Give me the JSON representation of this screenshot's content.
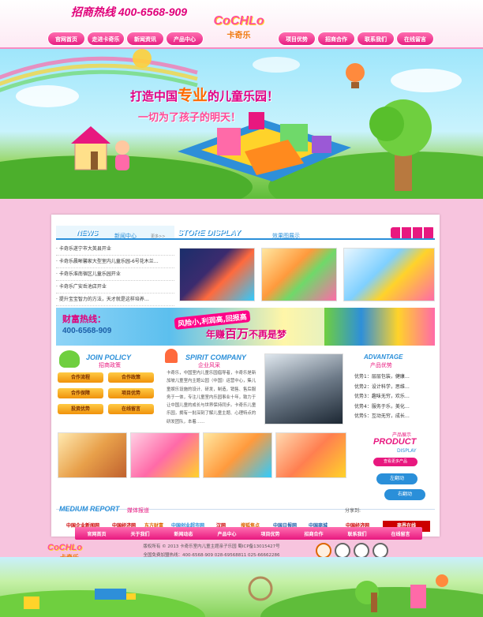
{
  "header": {
    "hotline_label": "招商热线",
    "hotline_number": "400-6568-909",
    "logo_en": "CoCHLo",
    "logo_cn": "卡奇乐"
  },
  "nav_left": [
    "官网首页",
    "走进卡奇乐",
    "新闻资讯",
    "产品中心"
  ],
  "nav_right": [
    "项目优势",
    "招商合作",
    "联系我们",
    "在线留言"
  ],
  "banner": {
    "slogan_a": "打造中国",
    "slogan_b": "专业",
    "slogan_c": "的儿童乐园！",
    "slogan2": "一切为了孩子的明天！",
    "dots": "●○○"
  },
  "news": {
    "title": "NEWS",
    "subtitle": "新闻中心",
    "more": "更多>>",
    "items": [
      "卡奇乐遂宁市大英县开业",
      "卡奇乐晨晰馨家大型室内儿童乐园-6号花木兰…",
      "卡奇乐淮南宿区儿童乐园开业",
      "卡奇乐广安岳池店开业",
      "提升宝宝智力的方法，天才就是这样培养…"
    ]
  },
  "store": {
    "title": "STORE DISPLAY",
    "subtitle": "效果图展示"
  },
  "hotbar": {
    "label": "财富热线：",
    "number": "400-6568-909",
    "tag": "风险小,利润高,回报高",
    "slogan_a": "年赚",
    "slogan_b": "百万",
    "slogan_c": "不再是梦"
  },
  "join": {
    "title": "JOIN POLICY",
    "subtitle": "招商政策",
    "buttons": [
      "合作流程",
      "合作政策",
      "合作保障",
      "项目优势",
      "投资优势",
      "在线留言"
    ]
  },
  "spirit": {
    "title": "SPIRIT COMPANY",
    "subtitle": "企业风采",
    "text": "卡奇乐，中国室内儿童乐园倡导者，卡奇乐是新加坡儿童室内主题公园（中国）运营中心，集儿童娱乐设施的设计、研发，制造，销售、售后服务于一体，专注儿童室内乐园事业十年，致力于让中国儿童的成长与世界保持同步。卡奇乐儿童乐园，拥有一批深刻了解儿童主题、心理特点的研发团队，本着……"
  },
  "advantage": {
    "title": "ADVANTAGE",
    "subtitle": "产品优势",
    "items": [
      "优势1：层层包装，健康…",
      "优势2：设计科学，思维…",
      "优势3：趣味无穷，欢乐…",
      "优势4：服务于乐，美化…",
      "优势5：互动无穷，成长…"
    ]
  },
  "product": {
    "title_cn": "产品展示",
    "title_en1": "PRODUCT",
    "title_en2": "DISPLAY",
    "more": "查看更多产品",
    "left": "左翻动",
    "right": "右翻动"
  },
  "media": {
    "title": "MEDIUM REPORT",
    "subtitle": "媒体报道",
    "share": "分享到:",
    "logos": [
      "中国企业新闻网",
      "中国经济网",
      "东方财富",
      "中国创业超市网",
      "汉网",
      "搜狐焦点",
      "中国日报网",
      "中国商城",
      "中国经济网",
      "商界在线"
    ]
  },
  "footer": {
    "nav": [
      "官网首页",
      "关于我们",
      "新闻动态",
      "产品中心",
      "项目优势",
      "招商合作",
      "联系我们",
      "在线留言"
    ],
    "logo_en": "CoCHLo",
    "logo_cn": "卡奇乐",
    "line1": "版权所有 © 2013  卡奇乐室内儿童主题亲子乐园  蜀ICP备13015427号",
    "line2": "全国免费加盟热线：400-6568-909          028-69568811   025-66662286"
  },
  "colors": {
    "accent": "#e8187f",
    "brand_blue": "#2a8fd9",
    "page_bg": "#f7c4de"
  }
}
